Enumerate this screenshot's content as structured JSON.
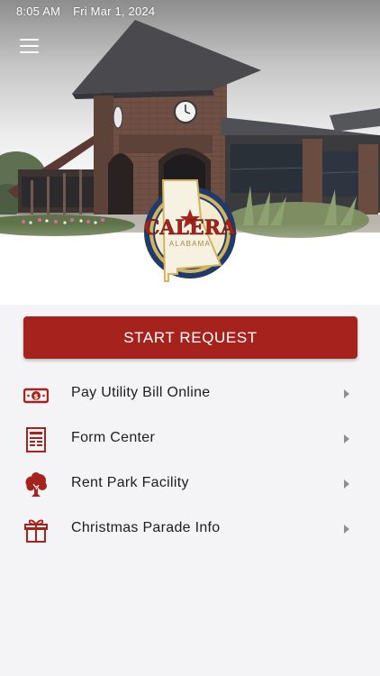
{
  "status_bar": {
    "time": "8:05 AM",
    "date": "Fri Mar 1, 2024"
  },
  "header": {
    "menu_icon": "hamburger-menu-icon"
  },
  "logo": {
    "city": "CALERA",
    "state": "ALABAMA"
  },
  "colors": {
    "accent": "#a5231c",
    "navy": "#1f3a6b",
    "gold": "#d2b45e"
  },
  "start_request": {
    "label": "START REQUEST"
  },
  "menu": {
    "items": [
      {
        "label": "Pay Utility Bill Online",
        "icon": "money-bill-icon"
      },
      {
        "label": "Form Center",
        "icon": "form-document-icon"
      },
      {
        "label": "Rent Park Facility",
        "icon": "tree-icon"
      },
      {
        "label": "Christmas Parade Info",
        "icon": "gift-icon"
      }
    ]
  }
}
